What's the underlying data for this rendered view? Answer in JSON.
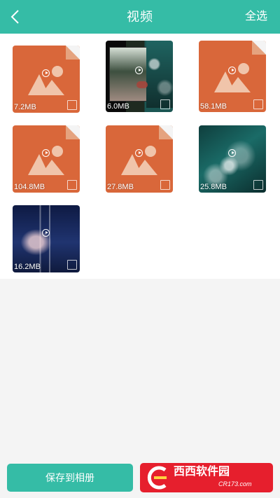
{
  "header": {
    "title": "视频",
    "select_all": "全选",
    "back_icon": "chevron-left-icon",
    "bg_color": "#35bca6"
  },
  "grid": {
    "items": [
      {
        "size": "7.2MB",
        "thumbnail": "placeholder-image-icon"
      },
      {
        "size": "6.0MB",
        "thumbnail": "video-frame"
      },
      {
        "size": "58.1MB",
        "thumbnail": "placeholder-image-icon"
      },
      {
        "size": "104.8MB",
        "thumbnail": "placeholder-image-icon"
      },
      {
        "size": "27.8MB",
        "thumbnail": "placeholder-image-icon"
      },
      {
        "size": "25.8MB",
        "thumbnail": "video-frame"
      },
      {
        "size": "16.2MB",
        "thumbnail": "video-frame"
      }
    ],
    "placeholder_color": "#d9673a"
  },
  "footer": {
    "save_label": "保存到相册",
    "watermark_text": "西西软件园",
    "watermark_sub": "CR173.com",
    "watermark_color": "#e61f2d"
  }
}
